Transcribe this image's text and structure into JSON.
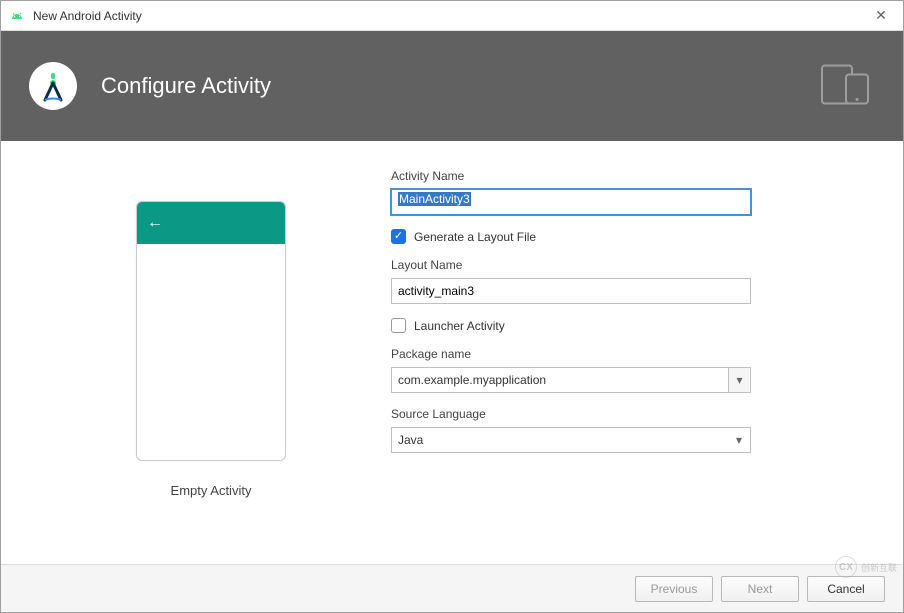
{
  "window": {
    "title": "New Android Activity"
  },
  "header": {
    "title": "Configure Activity"
  },
  "preview": {
    "caption": "Empty Activity"
  },
  "form": {
    "activity_name_label": "Activity Name",
    "activity_name_value": "MainActivity3",
    "generate_layout_label": "Generate a Layout File",
    "generate_layout_checked": true,
    "layout_name_label": "Layout Name",
    "layout_name_value": "activity_main3",
    "launcher_activity_label": "Launcher Activity",
    "launcher_activity_checked": false,
    "package_name_label": "Package name",
    "package_name_value": "com.example.myapplication",
    "source_language_label": "Source Language",
    "source_language_value": "Java"
  },
  "footer": {
    "previous": "Previous",
    "next": "Next",
    "cancel": "Cancel"
  },
  "watermark": {
    "brand": "CX",
    "text": "创新互联"
  }
}
